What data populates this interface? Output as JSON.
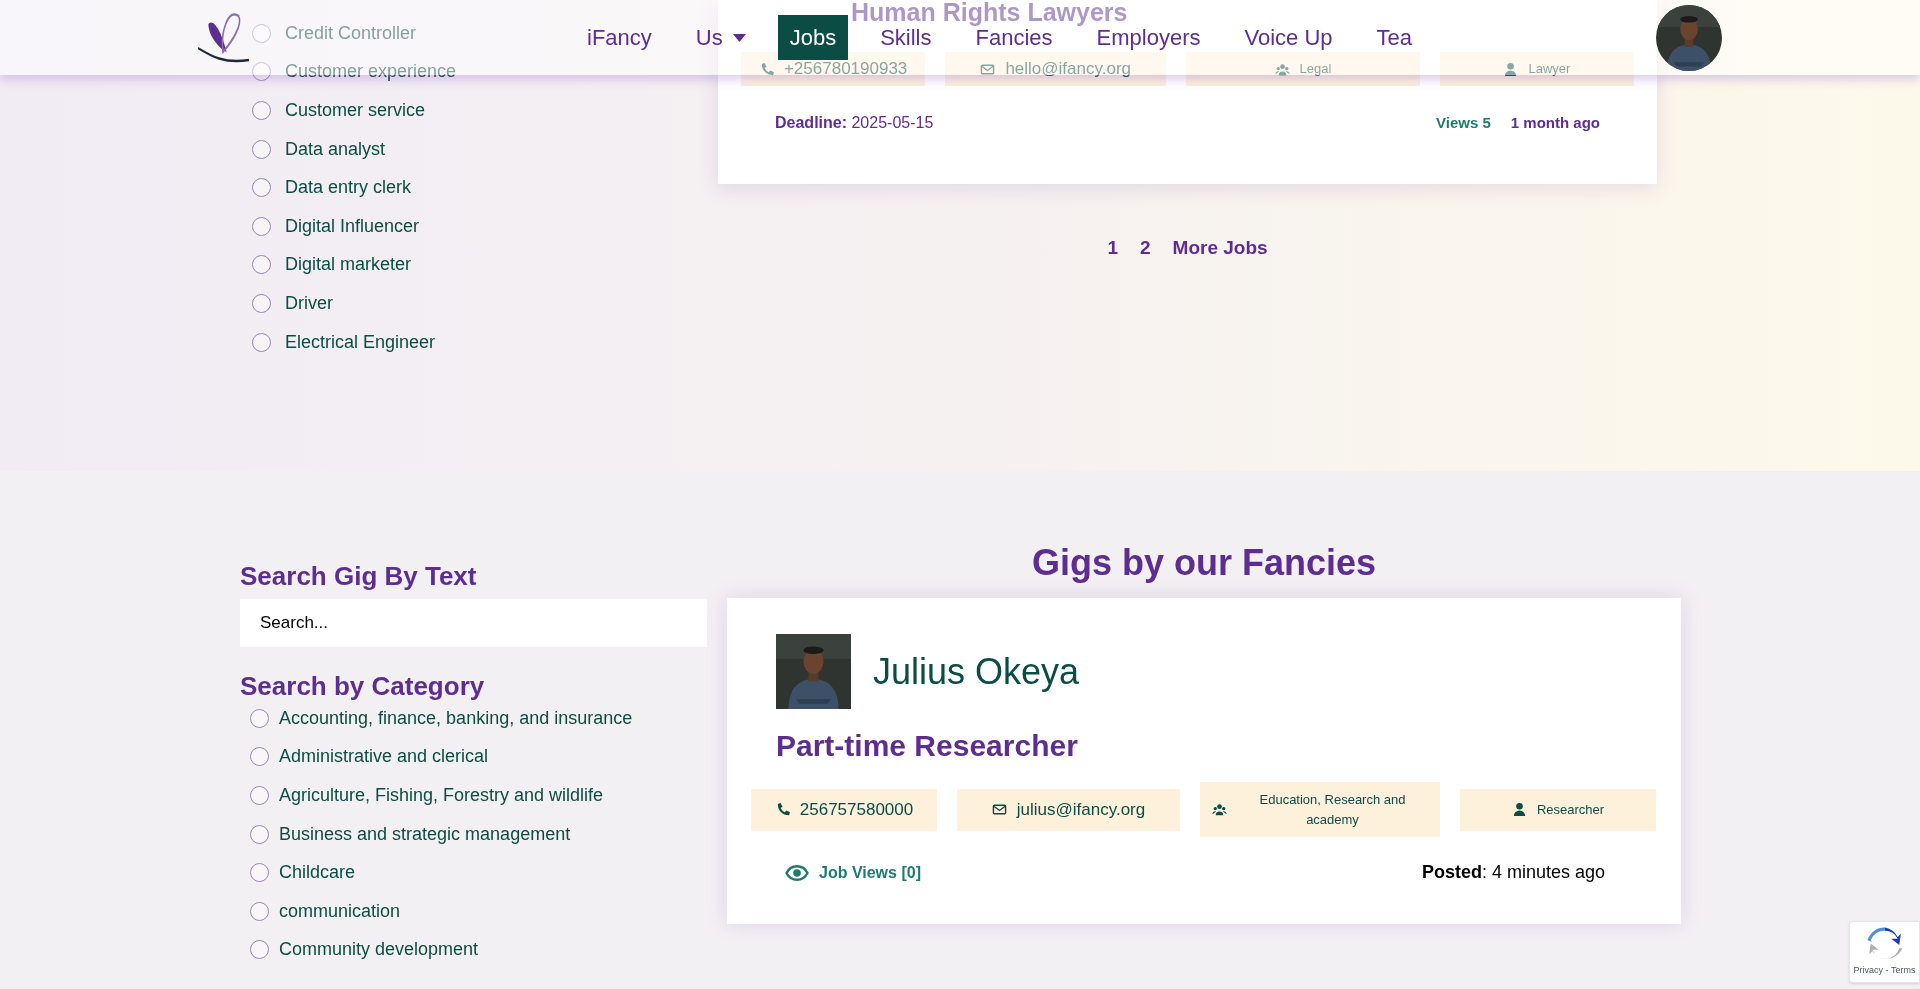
{
  "header": {
    "nav": [
      {
        "label": "iFancy",
        "selected": false
      },
      {
        "label": "Us",
        "selected": false,
        "dropdown": true
      },
      {
        "label": "Jobs",
        "selected": true
      },
      {
        "label": "Skills",
        "selected": false
      },
      {
        "label": "Fancies",
        "selected": false
      },
      {
        "label": "Employers",
        "selected": false
      },
      {
        "label": "Voice Up",
        "selected": false
      },
      {
        "label": "Tea",
        "selected": false
      }
    ]
  },
  "job_categories": [
    {
      "label": "Credit Controller",
      "checked": false
    },
    {
      "label": "Customer experience",
      "checked": false
    },
    {
      "label": "Customer service",
      "checked": false
    },
    {
      "label": "Data analyst",
      "checked": false
    },
    {
      "label": "Data entry clerk",
      "checked": false
    },
    {
      "label": "Digital Influencer",
      "checked": false
    },
    {
      "label": "Digital marketer",
      "checked": false
    },
    {
      "label": "Driver",
      "checked": false
    },
    {
      "label": "Electrical Engineer",
      "checked": false
    }
  ],
  "job_card": {
    "title": "Human Rights Lawyers",
    "phone": "+256780190933",
    "email": "hello@ifancy.org",
    "category": "Legal",
    "role": "Lawyer",
    "deadline": "**Deadline:** 2025-05-15",
    "views": "Views 5",
    "age": "1 month ago"
  },
  "pagination": {
    "pages": [
      {
        "label": "1"
      },
      {
        "label": "2"
      }
    ],
    "more": "More Jobs"
  },
  "gig_search": {
    "heading": "Search Gig By Text",
    "placeholder": "Search...",
    "category_heading": "Search by Category",
    "categories": [
      {
        "label": "Accounting, finance, banking, and insurance",
        "checked": false
      },
      {
        "label": "Administrative and clerical",
        "checked": false
      },
      {
        "label": "Agriculture, Fishing, Forestry and wildlife",
        "checked": false
      },
      {
        "label": "Business and strategic management",
        "checked": false
      },
      {
        "label": "Childcare",
        "checked": false
      },
      {
        "label": "communication",
        "checked": false
      },
      {
        "label": "Community development",
        "checked": false
      }
    ]
  },
  "gigs": {
    "heading": "Gigs by our Fancies",
    "cards": [
      {
        "name": "Julius Okeya",
        "title": "Part-time Researcher",
        "phone": "256757580000",
        "email": "julius@ifancy.org",
        "category": "Education, Research and academy",
        "role": "Researcher",
        "views": "Job Views [0]",
        "posted": "**Posted**: 4 minutes ago"
      }
    ]
  },
  "recaptcha": {
    "links": "Privacy - Terms"
  }
}
